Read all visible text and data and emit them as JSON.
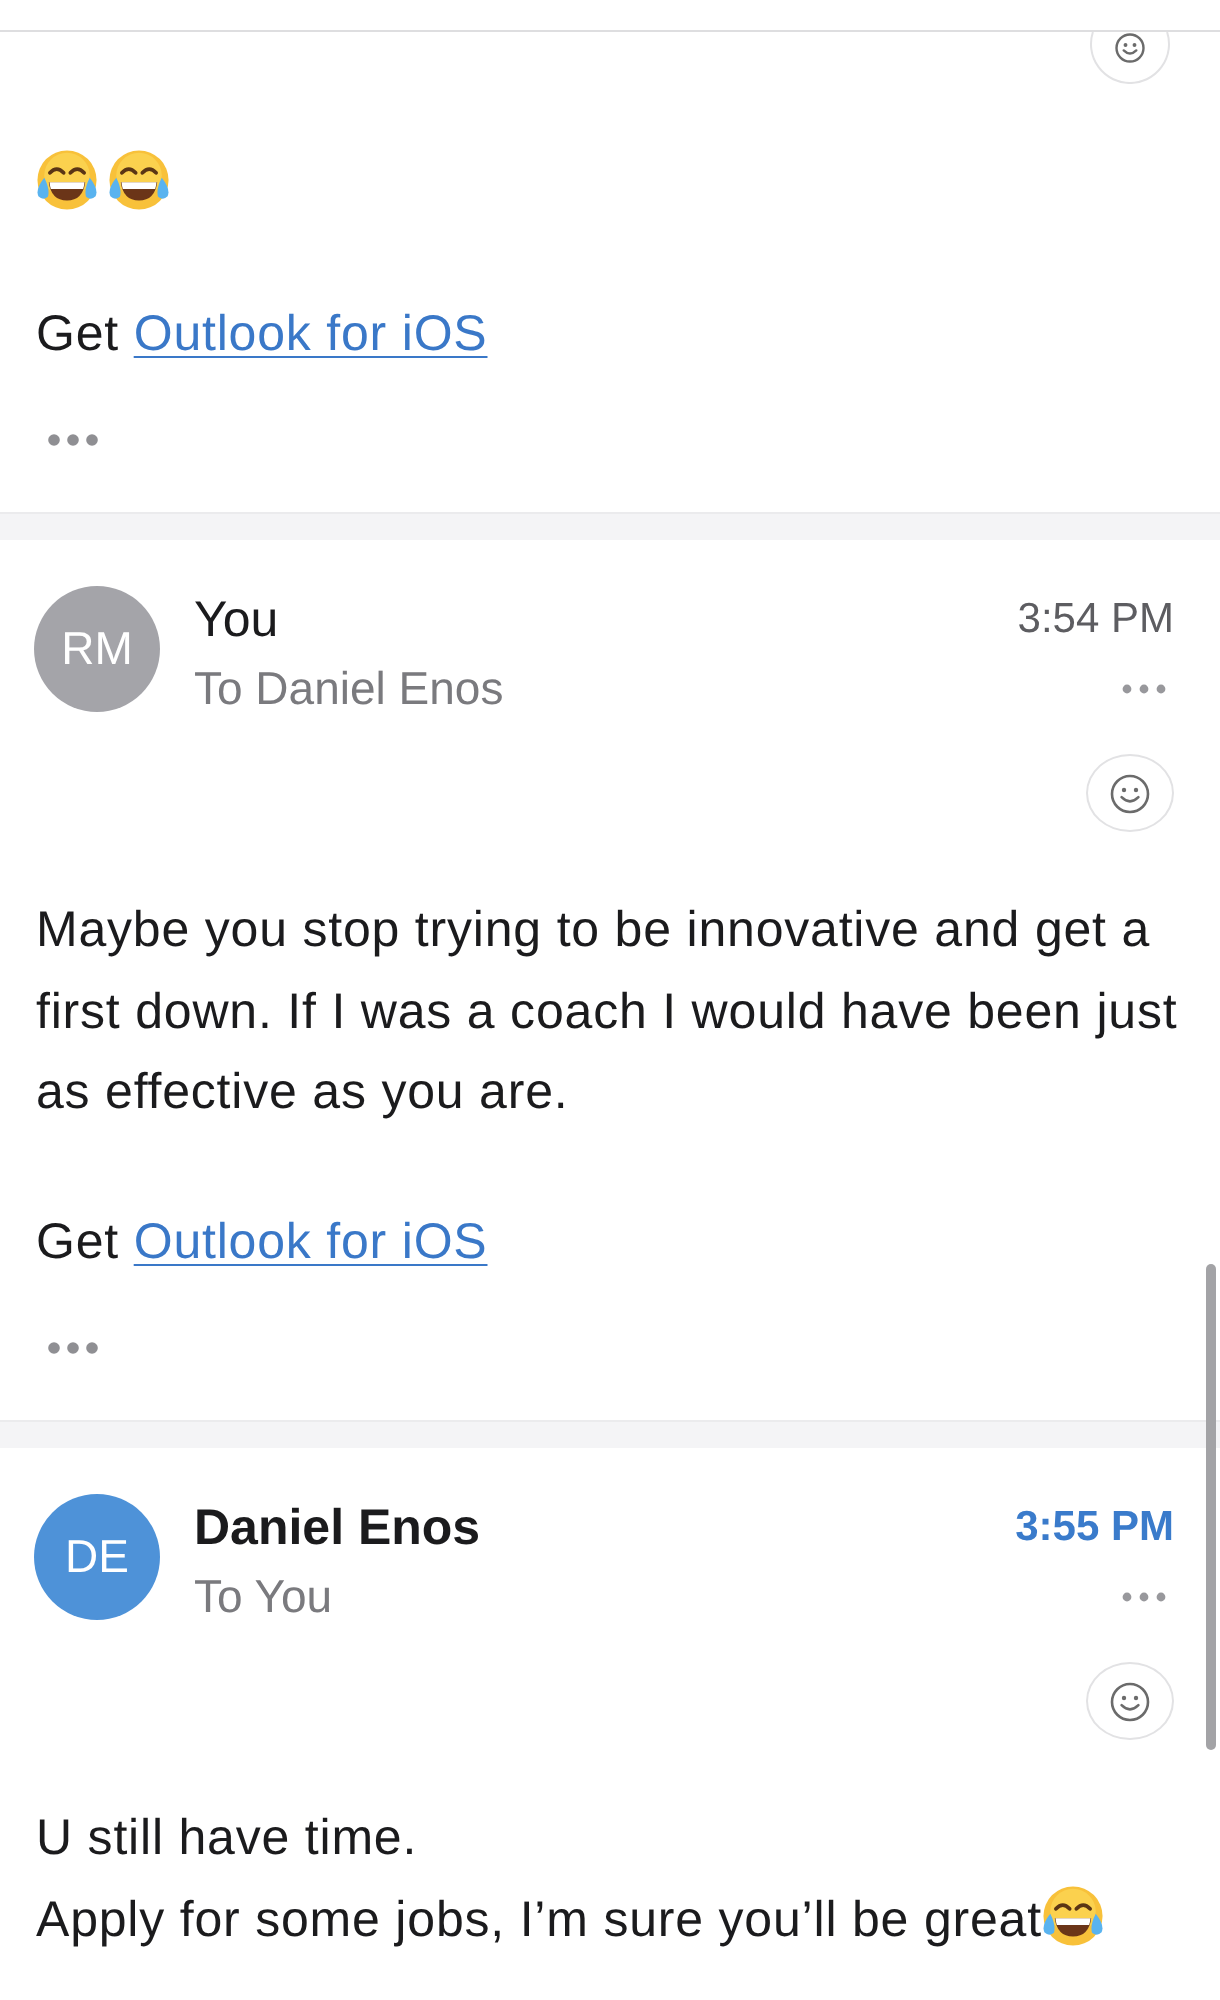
{
  "messages": [
    {
      "trimmed_content": true,
      "body": [
        {
          "lines": [
            [
              {
                "kind": "emoji"
              },
              {
                "kind": "emoji"
              }
            ]
          ]
        },
        {
          "lines": [
            [
              {
                "kind": "text",
                "text": "Get "
              },
              {
                "kind": "link",
                "text": "Outlook for iOS"
              }
            ]
          ]
        }
      ]
    },
    {
      "avatar": {
        "initials": "RM",
        "color": "#a4a4a9"
      },
      "sender": "You",
      "recipient": "To Daniel Enos",
      "time": "3:54 PM",
      "unread": false,
      "trimmed_content": true,
      "body": [
        {
          "lines": [
            [
              {
                "kind": "text",
                "text": "Maybe you stop trying to be innovative and get a first down. If I was a coach I would have been just as effective as you are."
              }
            ]
          ]
        },
        {
          "lines": [
            [
              {
                "kind": "text",
                "text": "Get "
              },
              {
                "kind": "link",
                "text": "Outlook for iOS"
              }
            ]
          ]
        }
      ]
    },
    {
      "avatar": {
        "initials": "DE",
        "color": "#4e92d8"
      },
      "sender": "Daniel Enos",
      "recipient": "To You",
      "time": "3:55 PM",
      "unread": true,
      "body": [
        {
          "lines": [
            [
              {
                "kind": "text",
                "text": "U still have time."
              }
            ],
            [
              {
                "kind": "text",
                "text": "Apply for some jobs, I’m sure you’ll be great"
              },
              {
                "kind": "emoji"
              }
            ]
          ]
        }
      ]
    }
  ]
}
